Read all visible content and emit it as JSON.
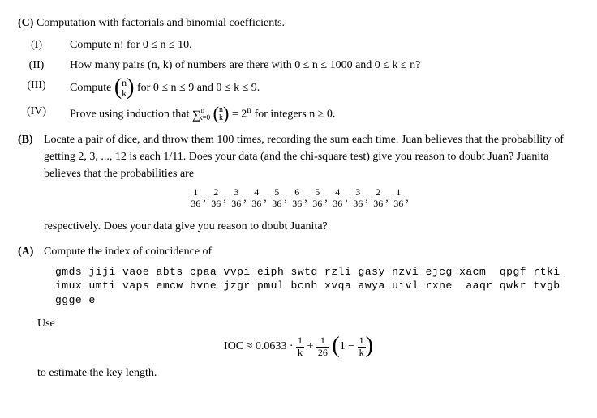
{
  "sectionC": {
    "label": "(C)",
    "title": "Computation with factorials and binomial coefficients."
  },
  "itemI": {
    "label": "(I)",
    "text": "Compute n! for 0 ≤ n ≤ 10."
  },
  "itemII": {
    "label": "(II)",
    "text": "How many pairs (n, k) of numbers are there with 0 ≤ n ≤ 1000 and 0 ≤ k ≤ n?"
  },
  "itemIII": {
    "label": "(III)",
    "prefix": "Compute ",
    "binom_top": "n",
    "binom_bot": "k",
    "suffix": " for 0 ≤ n ≤ 9 and 0 ≤ k ≤ 9."
  },
  "itemIV": {
    "label": "(IV)",
    "prefix": "Prove using induction that ",
    "sum_low": "k=0",
    "sum_high": "n",
    "binom_top": "n",
    "binom_bot": "k",
    "suffix1": " = 2",
    "suffix_exp": "n",
    "suffix2": " for integers n ≥ 0."
  },
  "sectionB": {
    "label": "(B)",
    "text1": "Locate a pair of dice, and throw them 100 times, recording the sum each time. Juan believes that the probability of getting 2, 3, ..., 12 is each 1/11. Does your data (and the chi-square test) give you reason to doubt Juan? Juanita believes that the probabilities are",
    "fractions": {
      "nums": [
        "1",
        "2",
        "3",
        "4",
        "5",
        "6",
        "5",
        "4",
        "3",
        "2",
        "1"
      ],
      "den": "36"
    },
    "text2": "respectively. Does your data give you reason to doubt Juanita?"
  },
  "sectionA": {
    "label": "(A)",
    "title": "Compute the index of coincidence of",
    "cipher_l1": "gmds jiji vaoe abts cpaa vvpi eiph swtq rzli gasy nzvi ejcg xacm  qpgf rtki",
    "cipher_l2": "imux umti vaps emcw bvne jzgr pmul bcnh xvqa awya uivl rxne  aaqr qwkr tvgb",
    "cipher_l3": "ggge e",
    "use": "Use",
    "ioc_lhs": "IOC ≈ 0.0633 · ",
    "frac1_num": "1",
    "frac1_den": "k",
    "plus": " + ",
    "frac2_num": "1",
    "frac2_den": "26",
    "one_minus": "1 − ",
    "frac3_num": "1",
    "frac3_den": "k",
    "tail": "to estimate the key length."
  }
}
